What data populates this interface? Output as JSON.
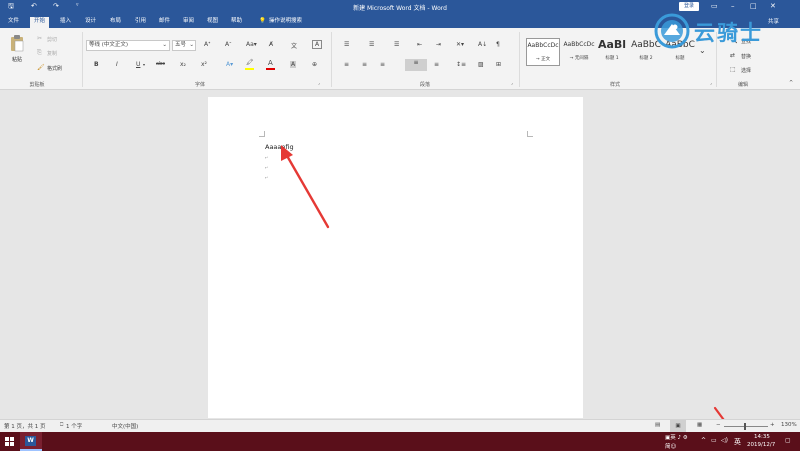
{
  "window": {
    "title": "新建 Microsoft Word 文档 - Word",
    "login_label": "登录",
    "user": "共享"
  },
  "tabs": [
    "文件",
    "开始",
    "插入",
    "设计",
    "布局",
    "引用",
    "邮件",
    "审阅",
    "视图",
    "帮助"
  ],
  "active_tab": "开始",
  "tell_me": "操作说明搜索",
  "clipboard": {
    "paste": "粘贴",
    "cut": "剪切",
    "copy": "复制",
    "format_painter": "格式刷",
    "group_label": "剪贴板"
  },
  "font": {
    "family": "等线 (中文正文)",
    "size": "五号",
    "bold": "B",
    "italic": "I",
    "underline": "U",
    "strike": "abc",
    "subscript": "x₂",
    "superscript": "x²",
    "font_color_letter": "A",
    "group_label": "字体"
  },
  "paragraph": {
    "group_label": "段落"
  },
  "styles": {
    "items": [
      {
        "preview": "AaBbCcDc",
        "label": "→ 正文"
      },
      {
        "preview": "AaBbCcDc",
        "label": "→ 无间隔"
      },
      {
        "preview": "AaBl",
        "label": "标题 1"
      },
      {
        "preview": "AaBbC",
        "label": "标题 2"
      },
      {
        "preview": "AaBbC",
        "label": "标题"
      }
    ],
    "group_label": "样式"
  },
  "editing": {
    "find": "查找",
    "replace": "替换",
    "select": "选择",
    "group_label": "编辑"
  },
  "document": {
    "text": "Aaaaefig"
  },
  "status": {
    "page": "第 1 页，共 1 页",
    "words": "1 个字",
    "language": "中文(中国)",
    "zoom": "130%"
  },
  "taskbar": {
    "ime_top": "英",
    "ime_bottom": "简",
    "volume": "◁)",
    "lang": "英",
    "time": "14:35",
    "date": "2019/12/7"
  },
  "watermark": "云骑士",
  "colors": {
    "word_blue": "#2b579a",
    "taskbar": "#5a0f1a",
    "annotation_red": "#e53935"
  }
}
